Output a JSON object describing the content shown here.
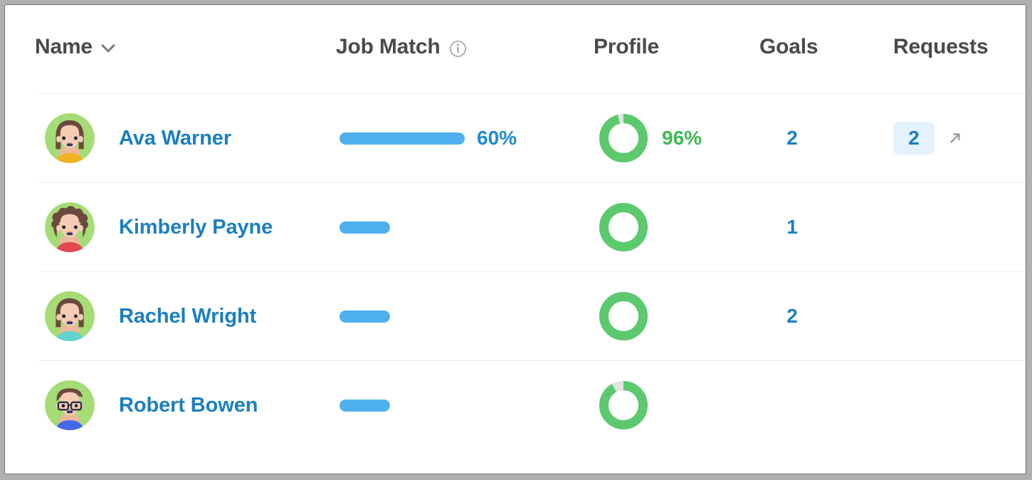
{
  "table": {
    "columns": [
      {
        "key": "name",
        "label": "Name",
        "icon": "chevron-down-icon"
      },
      {
        "key": "jobmatch",
        "label": "Job Match",
        "icon": "info-icon"
      },
      {
        "key": "profile",
        "label": "Profile",
        "icon": ""
      },
      {
        "key": "goals",
        "label": "Goals",
        "icon": ""
      },
      {
        "key": "requests",
        "label": "Requests",
        "icon": ""
      }
    ],
    "rows": [
      {
        "name": "Ava Warner",
        "avatar": "avatar-female-bob-yellow",
        "job_match_percent": 60,
        "job_match_label": "60%",
        "profile_percent": 96,
        "profile_label": "96%",
        "goals": "2",
        "requests": "2",
        "requests_arrow": "arrow-up-right-icon"
      },
      {
        "name": "Kimberly Payne",
        "avatar": "avatar-female-curly-red",
        "job_match_percent": 18,
        "job_match_label": "",
        "profile_percent": 100,
        "profile_label": "",
        "goals": "1",
        "requests": "",
        "requests_arrow": ""
      },
      {
        "name": "Rachel Wright",
        "avatar": "avatar-female-bob-teal",
        "job_match_percent": 18,
        "job_match_label": "",
        "profile_percent": 100,
        "profile_label": "",
        "goals": "2",
        "requests": "",
        "requests_arrow": ""
      },
      {
        "name": "Robert Bowen",
        "avatar": "avatar-male-glasses-blue",
        "job_match_percent": 18,
        "job_match_label": "",
        "profile_percent": 92,
        "profile_label": "",
        "goals": "",
        "requests": "",
        "requests_arrow": ""
      }
    ]
  },
  "colors": {
    "link_blue": "#1b7fc0",
    "bar_blue": "#4fb0ee",
    "ring_green": "#5cc96e",
    "ring_track": "#e3e3e3",
    "text_green": "#3cba54",
    "badge_bg": "#e3f2fd",
    "header_text": "#4a4a4a",
    "divider": "#e9e9e9",
    "avatar_bg": "#a5dc76"
  }
}
